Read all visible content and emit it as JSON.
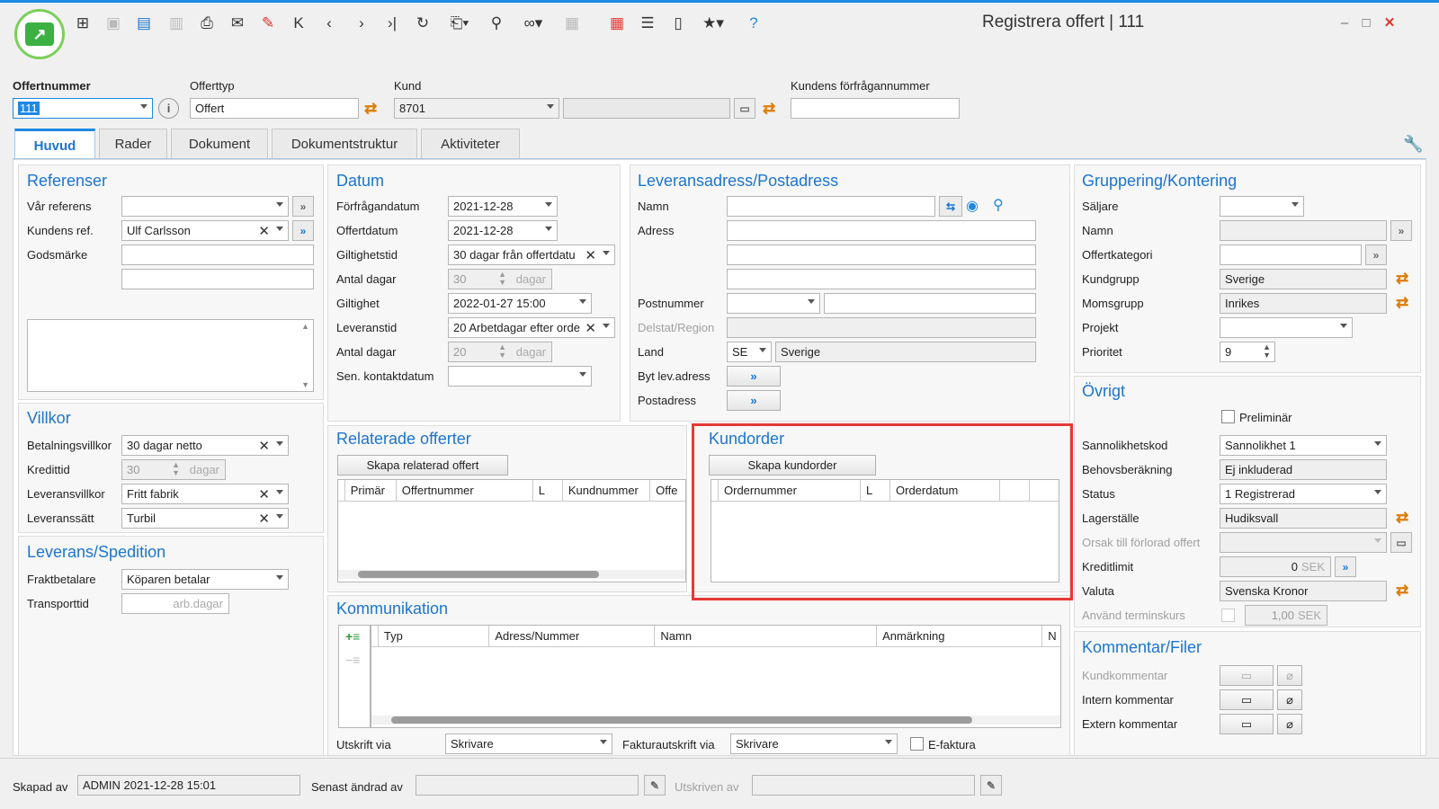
{
  "window": {
    "title": "Registrera offert | 111",
    "minimize": "–",
    "maximize": "□",
    "close": "✕"
  },
  "header": {
    "offertnummer_label": "Offertnummer",
    "offertnummer_value": "111",
    "offerttyp_label": "Offerttyp",
    "offerttyp_value": "Offert",
    "kund_label": "Kund",
    "kund_value": "8701",
    "kund_name_value": "",
    "kundens_label": "Kundens förfrågannummer",
    "kundens_value": ""
  },
  "tabs": [
    "Huvud",
    "Rader",
    "Dokument",
    "Dokumentstruktur",
    "Aktiviteter"
  ],
  "referenser": {
    "title": "Referenser",
    "var_referens_label": "Vår referens",
    "var_referens_value": "",
    "kundens_ref_label": "Kundens ref.",
    "kundens_ref_value": "Ulf Carlsson",
    "godsmarke_label": "Godsmärke"
  },
  "villkor": {
    "title": "Villkor",
    "betalningsvillkor_label": "Betalningsvillkor",
    "betalningsvillkor_value": "30 dagar netto",
    "kredittid_label": "Kredittid",
    "kredittid_value": "30",
    "kredittid_unit": "dagar",
    "leveransvillkor_label": "Leveransvillkor",
    "leveransvillkor_value": "Fritt fabrik",
    "leveranssatt_label": "Leveranssätt",
    "leveranssatt_value": "Turbil"
  },
  "leverans_spedition": {
    "title": "Leverans/Spedition",
    "fraktbetalare_label": "Fraktbetalare",
    "fraktbetalare_value": "Köparen betalar",
    "transporttid_label": "Transporttid",
    "transporttid_unit": "arb.dagar"
  },
  "datum": {
    "title": "Datum",
    "forfragandatum_label": "Förfrågandatum",
    "forfragandatum_value": "2021-12-28",
    "offertdatum_label": "Offertdatum",
    "offertdatum_value": "2021-12-28",
    "giltighetstid_label": "Giltighetstid",
    "giltighetstid_value": "30 dagar från offertdatu",
    "antal_dagar_label": "Antal dagar",
    "antal_dagar_value": "30",
    "dagar_unit": "dagar",
    "giltighet_label": "Giltighet",
    "giltighet_value": "2022-01-27 15:00",
    "leveranstid_label": "Leveranstid",
    "leveranstid_value": "20 Arbetdagar efter orde",
    "antal_dagar2_label": "Antal dagar",
    "antal_dagar2_value": "20",
    "sen_kontakt_label": "Sen. kontaktdatum",
    "sen_kontakt_value": ""
  },
  "leveransadress": {
    "title": "Leveransadress/Postadress",
    "namn_label": "Namn",
    "adress_label": "Adress",
    "postnummer_label": "Postnummer",
    "delstat_label": "Delstat/Region",
    "land_label": "Land",
    "land_code": "SE",
    "land_name": "Sverige",
    "byt_label": "Byt lev.adress",
    "postadress_label": "Postadress"
  },
  "gruppering": {
    "title": "Gruppering/Kontering",
    "saljare_label": "Säljare",
    "namn_label": "Namn",
    "offertkategori_label": "Offertkategori",
    "kundgrupp_label": "Kundgrupp",
    "kundgrupp_value": "Sverige",
    "momsgrupp_label": "Momsgrupp",
    "momsgrupp_value": "Inrikes",
    "projekt_label": "Projekt",
    "prioritet_label": "Prioritet",
    "prioritet_value": "9"
  },
  "ovrigt": {
    "title": "Övrigt",
    "preliminar_label": "Preliminär",
    "sannolikhetskod_label": "Sannolikhetskod",
    "sannolikhetskod_value": "Sannolikhet 1",
    "behovsberakning_label": "Behovsberäkning",
    "behovsberakning_value": "Ej inkluderad",
    "status_label": "Status",
    "status_value": "1 Registrerad",
    "lagerstalle_label": "Lagerställe",
    "lagerstalle_value": "Hudiksvall",
    "orsak_label": "Orsak till förlorad offert",
    "kreditlimit_label": "Kreditlimit",
    "kreditlimit_value": "0",
    "kreditlimit_unit": "SEK",
    "valuta_label": "Valuta",
    "valuta_value": "Svenska Kronor",
    "anvand_label": "Använd terminskurs",
    "anvand_value": "1,00",
    "anvand_unit": "SEK"
  },
  "kommentar": {
    "title": "Kommentar/Filer",
    "kundkommentar_label": "Kundkommentar",
    "intern_label": "Intern kommentar",
    "extern_label": "Extern kommentar"
  },
  "relaterade": {
    "title": "Relaterade offerter",
    "button": "Skapa relaterad offert",
    "columns": [
      "Primär",
      "Offertnummer",
      "L",
      "Kundnummer",
      "Offe"
    ]
  },
  "kundorder": {
    "title": "Kundorder",
    "button": "Skapa kundorder",
    "columns": [
      "Ordernummer",
      "L",
      "Orderdatum",
      "",
      ""
    ]
  },
  "kommunikation": {
    "title": "Kommunikation",
    "columns": [
      "Typ",
      "Adress/Nummer",
      "Namn",
      "Anmärkning",
      "N"
    ],
    "utskrift_label": "Utskrift via",
    "utskrift_value": "Skrivare",
    "fakturautskrift_label": "Fakturautskrift via",
    "fakturautskrift_value": "Skrivare",
    "efaktura_label": "E-faktura"
  },
  "statusbar": {
    "skapad_label": "Skapad av",
    "skapad_value": "ADMIN 2021-12-28 15:01",
    "andrad_label": "Senast ändrad av",
    "utskriven_label": "Utskriven av"
  },
  "colors": {
    "accent": "#1b75d0",
    "highlight": "#e53935",
    "brand_green": "#3cb043"
  }
}
